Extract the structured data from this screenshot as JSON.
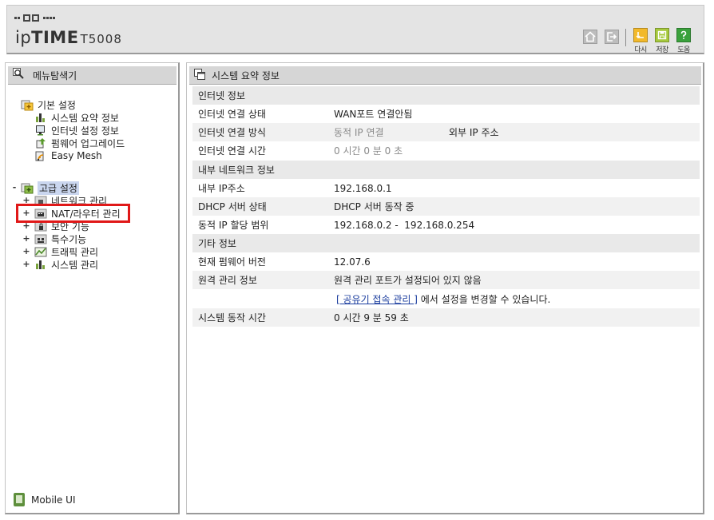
{
  "header": {
    "brand_prefix": "ip",
    "brand_main": "TIME",
    "brand_model": "T5008",
    "buttons": {
      "home_icon": "home-icon",
      "logout_icon": "logout-icon",
      "refresh_label": "다시",
      "save_label": "저장",
      "help_label": "도움"
    }
  },
  "sidebar": {
    "title": "메뉴탐색기",
    "basic": {
      "label": "기본 설정",
      "items": [
        "시스템 요약 정보",
        "인터넷 설정 정보",
        "펌웨어 업그레이드",
        "Easy Mesh"
      ]
    },
    "advanced": {
      "toggle": "-",
      "label": "고급 설정",
      "items": [
        {
          "toggle": "+",
          "label": "네트워크 관리"
        },
        {
          "toggle": "+",
          "label": "NAT/라우터 관리"
        },
        {
          "toggle": "+",
          "label": "보안 기능"
        },
        {
          "toggle": "+",
          "label": "특수기능"
        },
        {
          "toggle": "+",
          "label": "트래픽 관리"
        },
        {
          "toggle": "+",
          "label": "시스템 관리"
        }
      ]
    },
    "mobile_ui": "Mobile UI"
  },
  "main": {
    "title": "시스템 요약 정보",
    "internet": {
      "heading": "인터넷 정보",
      "status_label": "인터넷 연결 상태",
      "status_value": "WAN포트 연결안됨",
      "method_label": "인터넷 연결 방식",
      "method_value": "동적 IP 연결",
      "external_ip_label": "외부 IP 주소",
      "time_label": "인터넷 연결 시간",
      "time_value": "0 시간 0 분 0 초"
    },
    "internal": {
      "heading": "내부 네트워크 정보",
      "ip_label": "내부 IP주소",
      "ip_value": "192.168.0.1",
      "dhcp_label": "DHCP 서버 상태",
      "dhcp_value": "DHCP 서버 동작 중",
      "range_label": "동적 IP 할당 범위",
      "range_value": "192.168.0.2 -  192.168.0.254"
    },
    "other": {
      "heading": "기타 정보",
      "fw_label": "현재 펌웨어 버전",
      "fw_value": "12.07.6",
      "remote_label": "원격 관리 정보",
      "remote_value": "원격 관리 포트가 설정되어 있지 않음",
      "link_text": "[ 공유기 접속 관리 ]",
      "link_suffix": " 에서 설정을 변경할 수 있습니다.",
      "uptime_label": "시스템 동작 시간",
      "uptime_value": "0 시간 9 분 59 초"
    }
  }
}
